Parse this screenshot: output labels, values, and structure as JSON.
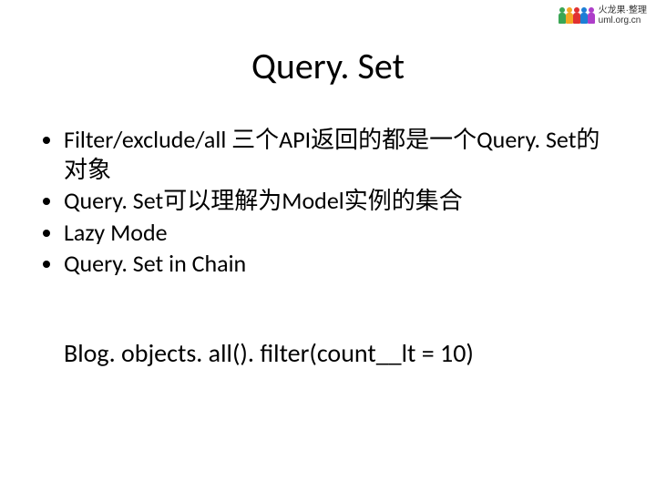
{
  "logo": {
    "line1": "火龙果·整理",
    "line2": "uml.org.cn"
  },
  "title": "Query. Set",
  "bullets": [
    "Filter/exclude/all 三个API返回的都是一个Query. Set的对象",
    "Query. Set可以理解为Model实例的集合",
    "Lazy Mode",
    "Query. Set in Chain"
  ],
  "code": "Blog. objects. all(). filter(count__lt = 10)"
}
